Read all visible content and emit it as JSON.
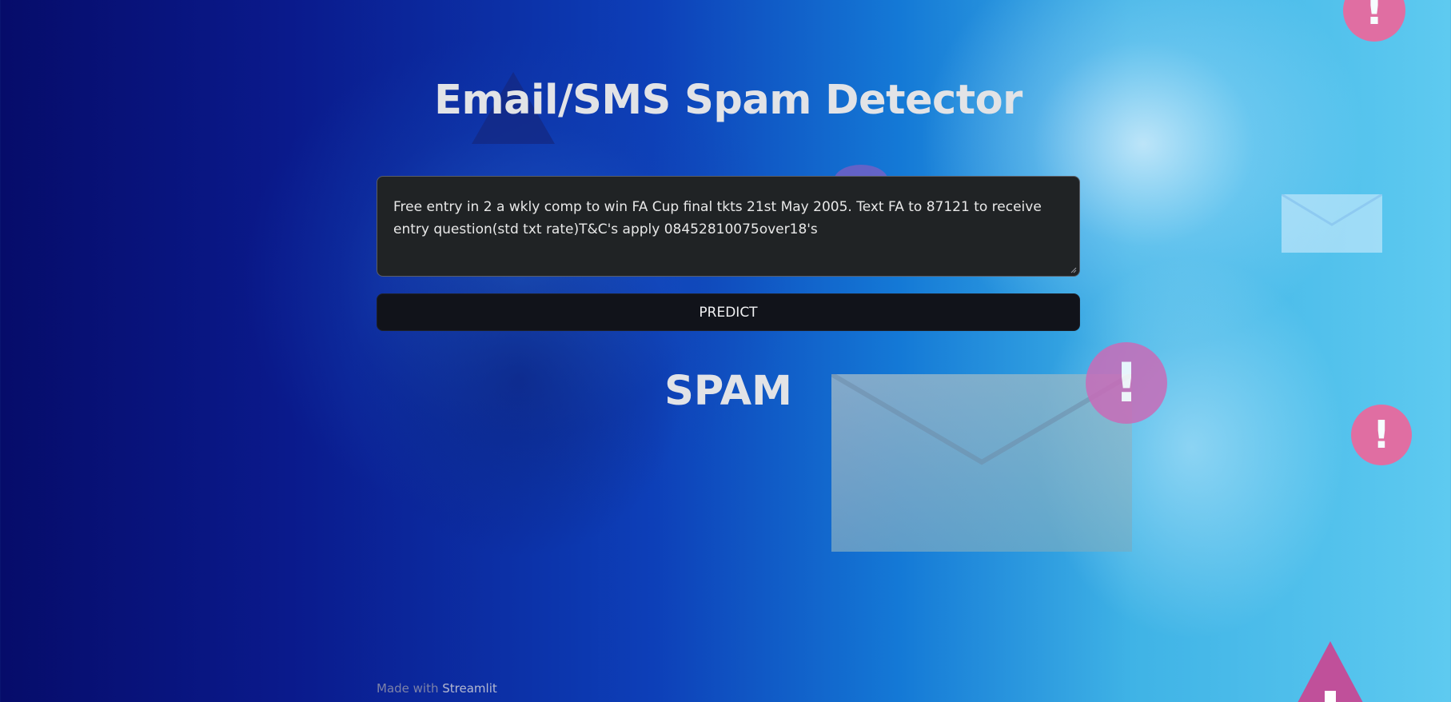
{
  "app": {
    "title": "Email/SMS Spam Detector"
  },
  "input": {
    "value": "Free entry in 2 a wkly comp to win FA Cup final tkts 21st May 2005. Text FA to 87121 to receive entry question(std txt rate)T&C's apply 08452810075over18's",
    "placeholder": ""
  },
  "actions": {
    "predict_label": "PREDICT"
  },
  "result": {
    "label": "SPAM"
  },
  "footer": {
    "prefix": "Made with",
    "link_label": "Streamlit"
  },
  "icons": [
    "envelope-icon",
    "alert-icon",
    "warning-triangle-icon",
    "resize-handle-icon"
  ],
  "colors": {
    "background_dark": "#060c6a",
    "background_light": "#5ecaf0",
    "textarea_bg": "#202325",
    "button_bg": "#11131a",
    "heading_text": "#e2e3e6",
    "alert_pink": "#e86a9e"
  }
}
